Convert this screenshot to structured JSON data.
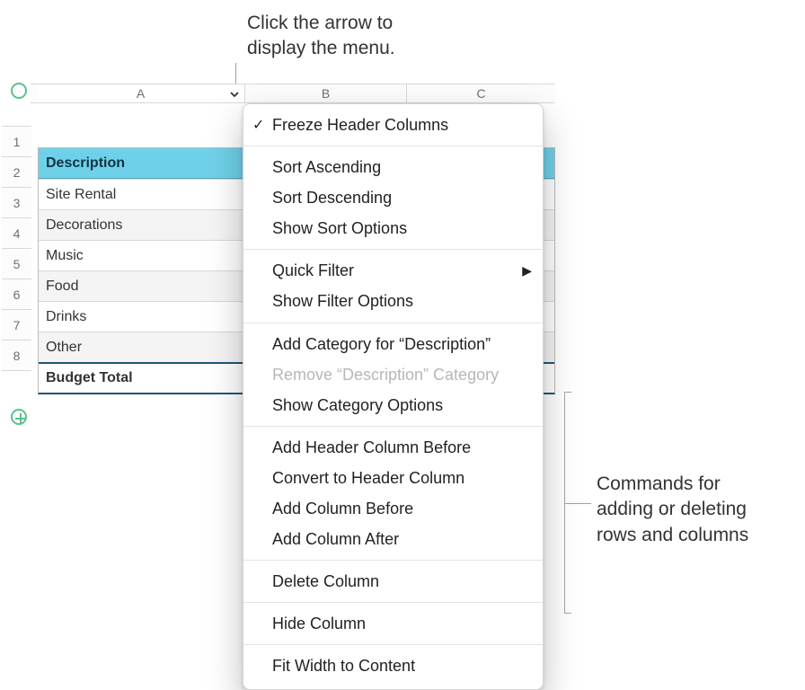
{
  "callouts": {
    "top": "Click the arrow to display the menu.",
    "right": "Commands for adding or deleting rows and columns"
  },
  "columns": {
    "a": "A",
    "b": "B",
    "c": "C"
  },
  "rowNumbers": [
    "1",
    "2",
    "3",
    "4",
    "5",
    "6",
    "7",
    "8"
  ],
  "table": {
    "header": "Description",
    "rows": [
      "Site Rental",
      "Decorations",
      "Music",
      "Food",
      "Drinks",
      "Other"
    ],
    "total": "Budget Total"
  },
  "menu": {
    "freeze": "Freeze Header Columns",
    "sortAsc": "Sort Ascending",
    "sortDesc": "Sort Descending",
    "sortOpts": "Show Sort Options",
    "quickFilter": "Quick Filter",
    "filterOpts": "Show Filter Options",
    "addCat": "Add Category for “Description”",
    "removeCat": "Remove “Description” Category",
    "catOpts": "Show Category Options",
    "addHdrBefore": "Add Header Column Before",
    "convertHdr": "Convert to Header Column",
    "addBefore": "Add Column Before",
    "addAfter": "Add Column After",
    "delete": "Delete Column",
    "hide": "Hide Column",
    "fit": "Fit Width to Content"
  }
}
